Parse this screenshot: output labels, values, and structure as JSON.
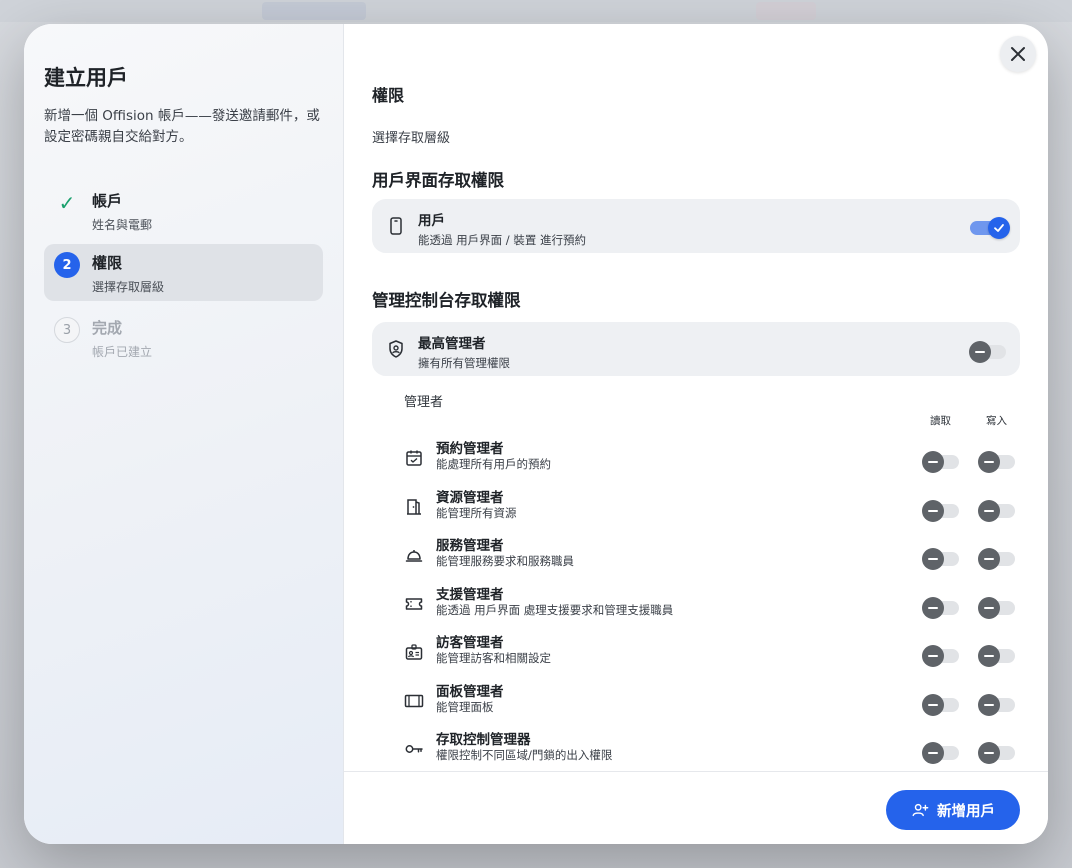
{
  "sidebar": {
    "title": "建立用戶",
    "description": "新增一個 Offision 帳戶——發送邀請郵件，或設定密碼親自交給對方。",
    "steps": [
      {
        "label": "帳戶",
        "sub": "姓名與電郵",
        "state": "done",
        "mark": "✓"
      },
      {
        "label": "權限",
        "sub": "選擇存取層級",
        "state": "current",
        "mark": "2"
      },
      {
        "label": "完成",
        "sub": "帳戶已建立",
        "state": "todo",
        "mark": "3"
      }
    ]
  },
  "main": {
    "section_title": "權限",
    "section_sub": "選擇存取層級",
    "user_access": {
      "heading": "用戶界面存取權限",
      "card": {
        "title": "用戶",
        "sub": "能透過 用戶界面 / 裝置 進行預約",
        "enabled": true,
        "icon": "phone-icon"
      }
    },
    "admin_access": {
      "heading": "管理控制台存取權限",
      "super_admin": {
        "title": "最高管理者",
        "sub": "擁有所有管理權限",
        "enabled": false,
        "icon": "shield-icon"
      },
      "admins_label": "管理者",
      "col_read": "讀取",
      "col_write": "寫入",
      "roles": [
        {
          "title": "預約管理者",
          "sub": "能處理所有用戶的預約",
          "icon": "calendar-check-icon",
          "read": false,
          "write": false
        },
        {
          "title": "資源管理者",
          "sub": "能管理所有資源",
          "icon": "door-icon",
          "read": false,
          "write": false
        },
        {
          "title": "服務管理者",
          "sub": "能管理服務要求和服務職員",
          "icon": "service-bell-icon",
          "read": false,
          "write": false
        },
        {
          "title": "支援管理者",
          "sub": "能透過 用戶界面 處理支援要求和管理支援職員",
          "icon": "ticket-icon",
          "read": false,
          "write": false
        },
        {
          "title": "訪客管理者",
          "sub": "能管理訪客和相關設定",
          "icon": "visitor-badge-icon",
          "read": false,
          "write": false
        },
        {
          "title": "面板管理者",
          "sub": "能管理面板",
          "icon": "panel-icon",
          "read": false,
          "write": false
        },
        {
          "title": "存取控制管理器",
          "sub": "權限控制不同區域/門鎖的出入權限",
          "icon": "key-icon",
          "read": false,
          "write": false
        }
      ]
    }
  },
  "footer": {
    "add_user_label": "新增用戶"
  },
  "colors": {
    "accent": "#2563eb",
    "success": "#1aa06d"
  }
}
